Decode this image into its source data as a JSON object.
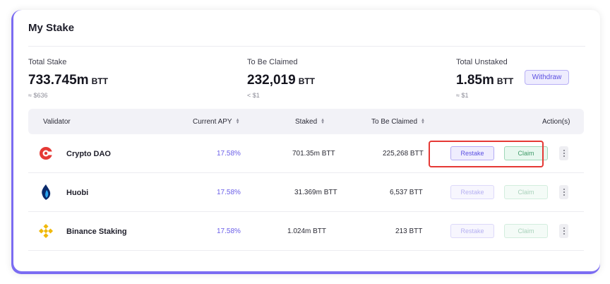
{
  "title": "My Stake",
  "stats": {
    "total_stake": {
      "label": "Total Stake",
      "value": "733.745m",
      "unit": "BTT",
      "sub": "≈ $636"
    },
    "to_be_claimed": {
      "label": "To Be Claimed",
      "value": "232,019",
      "unit": "BTT",
      "sub": "< $1"
    },
    "total_unstaked": {
      "label": "Total Unstaked",
      "value": "1.85m",
      "unit": "BTT",
      "sub": "≈ $1",
      "withdraw_label": "Withdraw"
    }
  },
  "table": {
    "headers": {
      "validator": "Validator",
      "apy": "Current APY",
      "staked": "Staked",
      "to_be_claimed": "To Be Claimed",
      "actions": "Action(s)"
    },
    "rows": [
      {
        "name": "Crypto DAO",
        "apy": "17.58%",
        "staked": "701.35m BTT",
        "claim": "225,268 BTT",
        "restake_label": "Restake",
        "claim_label": "Claim",
        "icon": "crypto-dao-logo"
      },
      {
        "name": "Huobi",
        "apy": "17.58%",
        "staked": "31.369m BTT",
        "claim": "6,537 BTT",
        "restake_label": "Restake",
        "claim_label": "Claim",
        "icon": "huobi-logo"
      },
      {
        "name": "Binance Staking",
        "apy": "17.58%",
        "staked": "1.024m BTT",
        "claim": "213 BTT",
        "restake_label": "Restake",
        "claim_label": "Claim",
        "icon": "binance-logo"
      }
    ]
  },
  "colors": {
    "accent": "#7b6cf2",
    "highlight": "#e53935",
    "claim_green": "#3f9a68"
  }
}
